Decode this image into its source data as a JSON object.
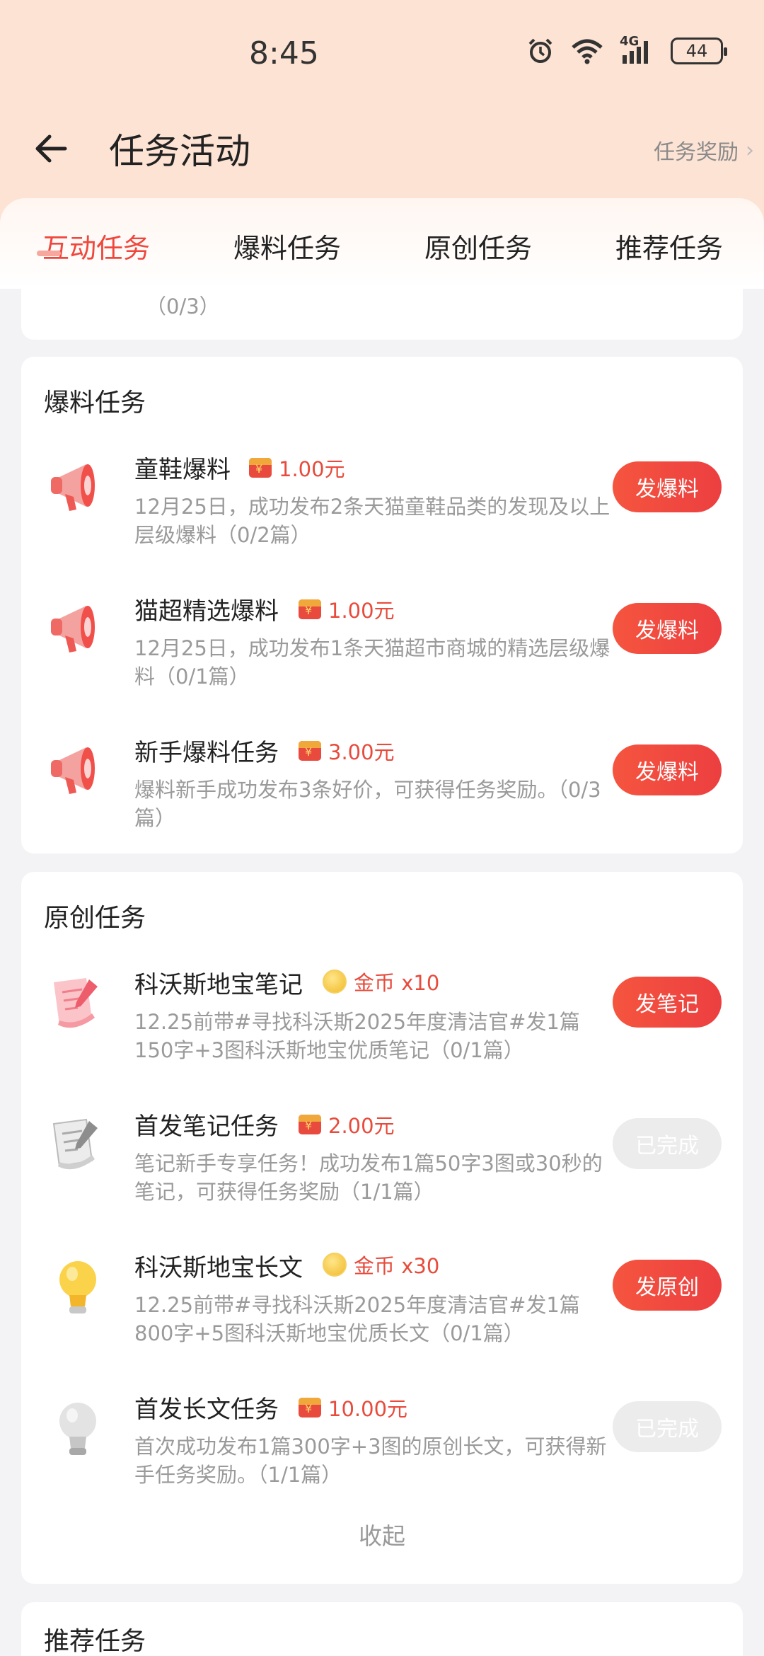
{
  "status_bar": {
    "time": "8:45",
    "network": "4G",
    "battery": "44"
  },
  "header": {
    "title": "任务活动",
    "reward_link": "任务奖励"
  },
  "tabs": [
    {
      "label": "互动任务",
      "active": true
    },
    {
      "label": "爆料任务",
      "active": false
    },
    {
      "label": "原创任务",
      "active": false
    },
    {
      "label": "推荐任务",
      "active": false
    }
  ],
  "prev_card": {
    "progress_tail": "（0/3）"
  },
  "baoliao": {
    "title": "爆料任务",
    "tasks": [
      {
        "name": "童鞋爆料",
        "reward_type": "cash",
        "reward": "1.00元",
        "desc": "12月25日，成功发布2条天猫童鞋品类的发现及以上层级爆料（0/2篇）",
        "button": "发爆料",
        "done": false,
        "icon": "megaphone-icon"
      },
      {
        "name": "猫超精选爆料",
        "reward_type": "cash",
        "reward": "1.00元",
        "desc": "12月25日，成功发布1条天猫超市商城的精选层级爆料（0/1篇）",
        "button": "发爆料",
        "done": false,
        "icon": "megaphone-icon"
      },
      {
        "name": "新手爆料任务",
        "reward_type": "cash",
        "reward": "3.00元",
        "desc": "爆料新手成功发布3条好价，可获得任务奖励。（0/3篇）",
        "button": "发爆料",
        "done": false,
        "icon": "megaphone-icon"
      }
    ]
  },
  "yuanchuang": {
    "title": "原创任务",
    "tasks": [
      {
        "name": "科沃斯地宝笔记",
        "reward_type": "coin",
        "reward": "金币 x10",
        "desc": "12.25前带#寻找科沃斯2025年度清洁官#发1篇150字+3图科沃斯地宝优质笔记（0/1篇）",
        "button": "发笔记",
        "done": false,
        "icon": "pink-note-icon"
      },
      {
        "name": "首发笔记任务",
        "reward_type": "cash",
        "reward": "2.00元",
        "desc": "笔记新手专享任务！成功发布1篇50字3图或30秒的笔记，可获得任务奖励（1/1篇）",
        "button": "已完成",
        "done": true,
        "icon": "grey-note-icon"
      },
      {
        "name": "科沃斯地宝长文",
        "reward_type": "coin",
        "reward": "金币 x30",
        "desc": "12.25前带#寻找科沃斯2025年度清洁官#发1篇800字+5图科沃斯地宝优质长文（0/1篇）",
        "button": "发原创",
        "done": false,
        "icon": "yellow-bulb-icon"
      },
      {
        "name": "首发长文任务",
        "reward_type": "cash",
        "reward": "10.00元",
        "desc": "首次成功发布1篇300字+3图的原创长文，可获得新手任务奖励。（1/1篇）",
        "button": "已完成",
        "done": true,
        "icon": "grey-bulb-icon"
      }
    ],
    "collapse": "收起"
  },
  "tuijian": {
    "title": "推荐任务"
  },
  "colors": {
    "accent": "#f0473d",
    "button": "#ec3f40",
    "reward": "#e84b3c",
    "header_bg": "#fde3d4",
    "muted": "#9a9a9a"
  }
}
